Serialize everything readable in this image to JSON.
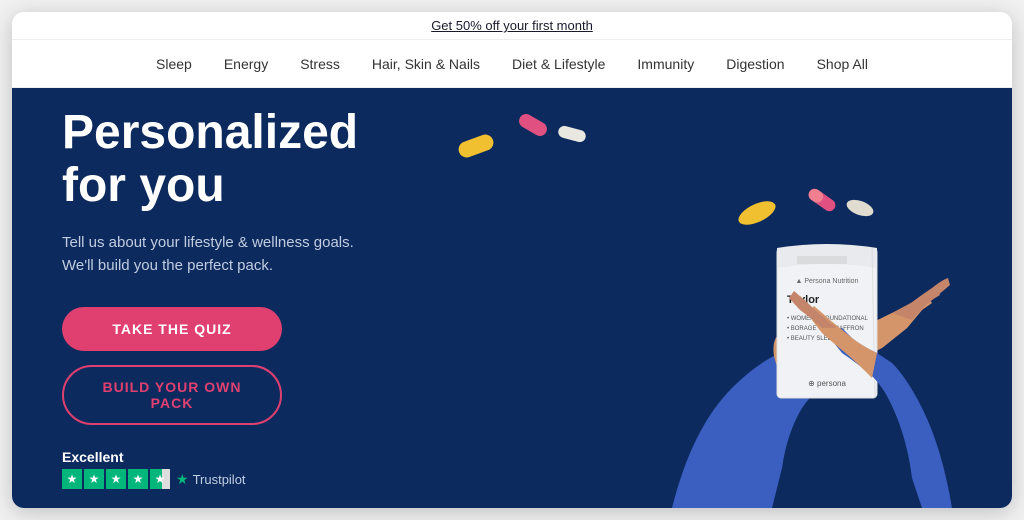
{
  "promo": {
    "text": "Get 50% off your first month"
  },
  "nav": {
    "items": [
      {
        "label": "Sleep",
        "href": "#"
      },
      {
        "label": "Energy",
        "href": "#"
      },
      {
        "label": "Stress",
        "href": "#"
      },
      {
        "label": "Hair, Skin & Nails",
        "href": "#"
      },
      {
        "label": "Diet & Lifestyle",
        "href": "#"
      },
      {
        "label": "Immunity",
        "href": "#"
      },
      {
        "label": "Digestion",
        "href": "#"
      },
      {
        "label": "Shop All",
        "href": "#"
      }
    ]
  },
  "hero": {
    "title": "Personalized\nfor you",
    "subtitle_line1": "Tell us about your lifestyle & wellness goals.",
    "subtitle_line2": "We'll build you the perfect pack.",
    "btn_quiz": "TAKE THE QUIZ",
    "btn_build": "BUILD YOUR OWN PACK",
    "trustpilot": {
      "rating_label": "Excellent",
      "brand": "Trustpilot"
    }
  },
  "packet": {
    "name": "Taylor",
    "line1": "WOMEN'S FOUNDATIONAL",
    "line2": "BORAGE WITH SAFFRON",
    "line3": "BEAUTY SLEEP",
    "brand": "persona"
  }
}
